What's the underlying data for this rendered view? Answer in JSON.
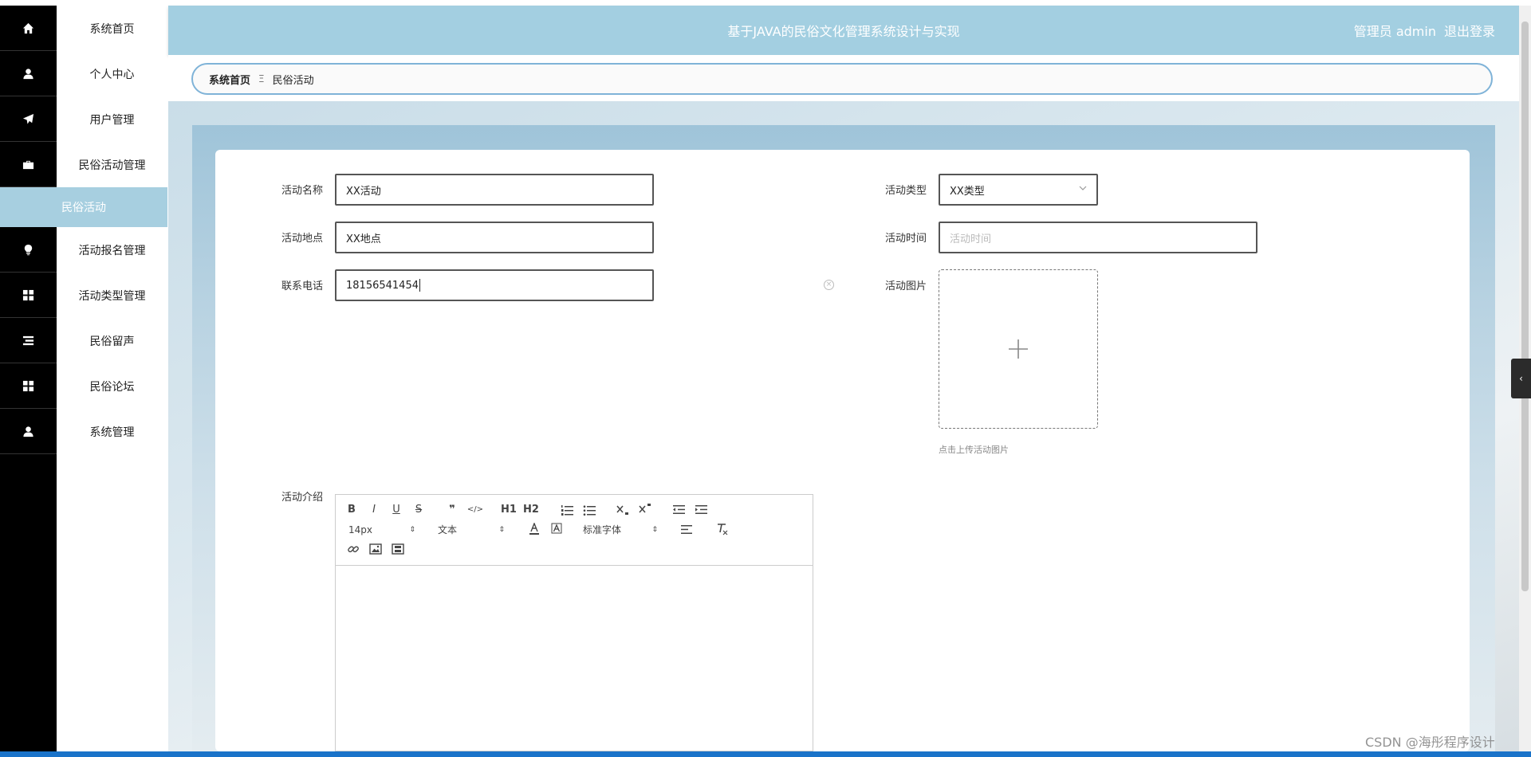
{
  "header": {
    "title": "基于JAVA的民俗文化管理系统设计与实现",
    "user_label": "管理员 admin",
    "logout_label": "退出登录"
  },
  "sidebar": {
    "items": [
      {
        "label": "系统首页",
        "icon": "home-icon"
      },
      {
        "label": "个人中心",
        "icon": "user-icon"
      },
      {
        "label": "用户管理",
        "icon": "paper-plane-icon"
      },
      {
        "label": "民俗活动管理",
        "icon": "briefcase-icon"
      },
      {
        "label": "活动报名管理",
        "icon": "lightbulb-icon"
      },
      {
        "label": "活动类型管理",
        "icon": "grid-icon"
      },
      {
        "label": "民俗留声",
        "icon": "list-icon"
      },
      {
        "label": "民俗论坛",
        "icon": "grid-icon"
      },
      {
        "label": "系统管理",
        "icon": "user-icon"
      }
    ],
    "active_sub": "民俗活动"
  },
  "breadcrumb": {
    "home": "系统首页",
    "separator": "Ξ",
    "current": "民俗活动"
  },
  "form": {
    "name_label": "活动名称",
    "name_value": "XX活动",
    "type_label": "活动类型",
    "type_value": "XX类型",
    "place_label": "活动地点",
    "place_value": "XX地点",
    "time_label": "活动时间",
    "time_placeholder": "活动时间",
    "phone_label": "联系电话",
    "phone_value": "18156541454",
    "image_label": "活动图片",
    "upload_tip": "点击上传活动图片",
    "intro_label": "活动介绍"
  },
  "editor": {
    "font_size": "14px",
    "format": "文本",
    "font_family": "标准字体",
    "buttons": [
      "B",
      "I",
      "U",
      "S",
      "❞",
      "</>",
      "H1",
      "H2"
    ]
  },
  "watermark": "CSDN @海彤程序设计",
  "colors": {
    "header_bg": "#a3cfe1",
    "sidebar_active": "#a7cfe0",
    "sidebar_icon_bg": "#000000",
    "crumb_border": "#7fb3d8"
  }
}
